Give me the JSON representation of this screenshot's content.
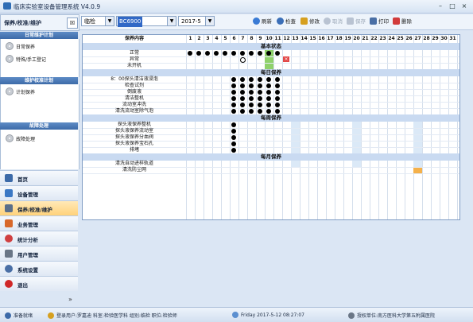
{
  "window": {
    "title": "临床实验室设备管理系统",
    "version": "V4.0.9",
    "min": "–",
    "max": "□",
    "close": "×"
  },
  "left_panel": {
    "header": "保养/校准/维护",
    "pin": "☒",
    "sections": [
      {
        "title": "日常维护计划",
        "items": [
          "日常保养",
          "特殊/手工登记"
        ]
      },
      {
        "title": "维护校准计划",
        "items": [
          "计划保养"
        ]
      },
      {
        "title": "故障处理",
        "items": [
          "故障处理"
        ]
      }
    ],
    "nav": [
      {
        "label": "首页",
        "color": "#3c6aa8"
      },
      {
        "label": "设备管理",
        "color": "#3b78c4"
      },
      {
        "label": "保养/校准/维护",
        "color": "#5b6f8a",
        "selected": true
      },
      {
        "label": "业务管理",
        "color": "#d8682a"
      },
      {
        "label": "统计分析",
        "color": "#d04040"
      },
      {
        "label": "用户管理",
        "color": "#6a7686"
      },
      {
        "label": "系统设置",
        "color": "#4a6fa5"
      },
      {
        "label": "退出",
        "color": "#d02828"
      }
    ],
    "more": "»"
  },
  "toolbar": {
    "dept": "临检",
    "device": "BC6900",
    "month": "2017-5",
    "buttons": [
      {
        "label": "刷新",
        "color": "#3a7bd5",
        "enabled": true
      },
      {
        "label": "检查",
        "color": "#3b6fb8",
        "enabled": true
      },
      {
        "label": "修改",
        "color": "#d6a020",
        "enabled": true
      },
      {
        "label": "取消",
        "color": "#9aa6b6",
        "enabled": false
      },
      {
        "label": "保存",
        "color": "#9aa6b6",
        "enabled": false
      },
      {
        "label": "打印",
        "color": "#4a6fa5",
        "enabled": true
      },
      {
        "label": "删除",
        "color": "#d23b3b",
        "enabled": true
      }
    ]
  },
  "grid": {
    "col_header": "保养内容",
    "days": [
      "1",
      "2",
      "3",
      "4",
      "5",
      "6",
      "7",
      "8",
      "9",
      "10",
      "11",
      "12",
      "13",
      "14",
      "15",
      "16",
      "17",
      "18",
      "19",
      "20",
      "21",
      "22",
      "23",
      "24",
      "25",
      "26",
      "27",
      "28",
      "29",
      "30",
      "31"
    ],
    "groups": [
      {
        "title": "基本状态",
        "rows": [
          {
            "label": "正常",
            "dots": [
              1,
              2,
              3,
              4,
              5,
              6,
              7,
              8,
              9,
              10,
              11
            ],
            "circles": [],
            "x": []
          },
          {
            "label": "异常",
            "dots": [],
            "circles": [
              7
            ],
            "x": [
              12
            ]
          },
          {
            "label": "未开机",
            "dots": [],
            "circles": [],
            "x": []
          }
        ]
      },
      {
        "title": "每日保养",
        "rows": [
          {
            "label": "8：00探头清洁液浸泡",
            "dots": [
              6,
              7,
              8,
              9,
              10,
              11
            ],
            "circles": [],
            "x": []
          },
          {
            "label": "检查试剂",
            "dots": [
              6,
              7,
              8,
              9,
              10,
              11
            ],
            "circles": [],
            "x": []
          },
          {
            "label": "倒废液",
            "dots": [
              6,
              7,
              8,
              9,
              10,
              11
            ],
            "circles": [],
            "x": []
          },
          {
            "label": "清洁整机",
            "dots": [
              6,
              7,
              8,
              9,
              10,
              11
            ],
            "circles": [],
            "x": []
          },
          {
            "label": "流动室冲洗",
            "dots": [
              6,
              7,
              8,
              9,
              10,
              11
            ],
            "circles": [],
            "x": []
          },
          {
            "label": "清洗流动室除气泡",
            "dots": [
              6,
              7,
              8,
              9,
              10,
              11
            ],
            "circles": [],
            "x": []
          }
        ]
      },
      {
        "title": "每周保养",
        "rows": [
          {
            "label": "探头液保养整机",
            "dots": [
              6
            ],
            "circles": [],
            "x": []
          },
          {
            "label": "探头液保养流动室",
            "dots": [
              6
            ],
            "circles": [],
            "x": []
          },
          {
            "label": "探头液保养分血阀",
            "dots": [
              6
            ],
            "circles": [],
            "x": []
          },
          {
            "label": "探头液保养宝石孔",
            "dots": [
              6
            ],
            "circles": [],
            "x": []
          },
          {
            "label": "排堵",
            "dots": [
              6
            ],
            "circles": [],
            "x": []
          }
        ]
      },
      {
        "title": "每月保养",
        "rows": [
          {
            "label": "清洗自动进样轨道",
            "dots": [],
            "circles": [],
            "x": []
          },
          {
            "label": "清洗防尘网",
            "dots": [],
            "circles": [],
            "x": []
          }
        ]
      }
    ]
  },
  "statusbar": {
    "ready": "准备就绪",
    "user": "登录用户:罗嘉迪  科室:检验医学科  组别:临检  职位:检验师",
    "datetime": "Friday 2017-5-12 08:27:07",
    "unit": "授权单位:南方医科大学第五附属医院"
  },
  "colors": {
    "accent": "#3c6aa8",
    "today_column": "#8fd16b",
    "weekend_column": "#dbe9f7",
    "highlight_cell": "#f5b14a",
    "error": "#e24848"
  }
}
